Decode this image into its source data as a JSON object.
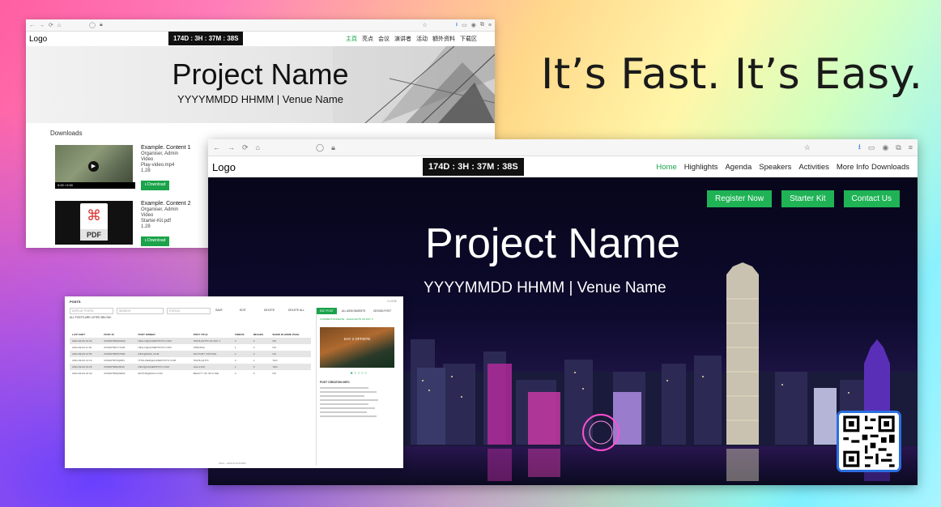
{
  "tagline": "It’s Fast. It’s Easy.",
  "window_small": {
    "logo": "Logo",
    "countdown": "174D : 3H : 37M : 38S",
    "nav": [
      "主頁",
      "亮点",
      "会议",
      "演讲者",
      "活动",
      "額外资料",
      "下载区"
    ],
    "hero_title": "Project Name",
    "hero_subtitle": "YYYYMMDD HHMM | Venue Name",
    "downloads_heading": "Downloads",
    "items": [
      {
        "name": "Example. Content 1",
        "org": "Organiser, Admin",
        "type": "Video",
        "file": "Play-video.mp4",
        "size": "1.28",
        "button": "Download",
        "player_time": "0:00 / 0:00"
      },
      {
        "name": "Example. Content 2",
        "org": "Organiser, Admin",
        "type": "Video",
        "file": "Starter-Kit.pdf",
        "size": "1.28",
        "button": "Download",
        "pdf_label": "PDF"
      }
    ]
  },
  "window_main": {
    "logo": "Logo",
    "countdown": "174D : 3H : 37M : 38S",
    "nav": [
      "Home",
      "Highlights",
      "Agenda",
      "Speakers",
      "Activities",
      "More Info",
      "Downloads"
    ],
    "buttons": [
      "Register Now",
      "Starter Kit",
      "Contact Us"
    ],
    "hero_title": "Project Name",
    "hero_subtitle": "YYYYMMDD HHMM | Venue Name",
    "colors": {
      "accent": "#1fb356",
      "qr_border": "#2b6fe0"
    }
  },
  "window_admin": {
    "title": "POSTS",
    "close": "CLOSE",
    "filters": [
      "DISPLAY POSTS",
      "SEARCH",
      "STATUS",
      "SAVE",
      "EDIT",
      "DELETE",
      "DELETE ALL"
    ],
    "subtitle": "ALL POSTS ARE LISTED BELOW :",
    "columns": [
      "LAST EDIT",
      "POST ID",
      "POST OWNER",
      "POST TITLE",
      "VIDEOS",
      "IMAGES",
      "SHOW IN HOME PAGE"
    ],
    "rows": [
      [
        "2024-09-09 10:20",
        "0X9NZTB5WA3DQ",
        "HELLO@ACMEPHOTO.COM",
        "HIGHLIGHTS OF DAY 1",
        "3",
        "2",
        "NO"
      ],
      [
        "2024-09-09 11:40",
        "0X9NZTBA7YK2M",
        "HELLO@ACMEPHOTO.COM",
        "OPENING",
        "1",
        "2",
        "NO"
      ],
      [
        "2024-09-09 12:55",
        "0X9NZTB6P4TWR",
        "INFO@MAIL.COM",
        "FACTORY VISITING",
        "1",
        "4",
        "NO"
      ],
      [
        "2024-09-09 14:10",
        "0X9NZTB7DQR8V",
        "THISUSER@ACMEPHOTO.COM",
        "HIGHLIGHTS",
        "2",
        "1",
        "YES"
      ],
      [
        "2024-09-09 15:25",
        "0X9NZTB8LMN3C",
        "INFO@ACMEPHOTO.COM",
        "GALA DAY",
        "1",
        "3",
        "YES"
      ],
      [
        "2024-09-09 16:40",
        "0X9NZTB9QWE5F",
        "EDITOR@MAIL.COM",
        "BEAUTY OF SKYLINE",
        "2",
        "5",
        "NO"
      ]
    ],
    "side_tabs": [
      "EDIT POST",
      "ALL ASSIGNMENTS",
      "DESIGN POST"
    ],
    "side_heading": "COMMENTS/CREATE - HIGHLIGHTS OF DAY 2",
    "slide_label": "DAY 2 OFFSITE",
    "detail_heading": "POST CREATION INFO",
    "footer": "2024 – 2026  PLATFORM"
  }
}
